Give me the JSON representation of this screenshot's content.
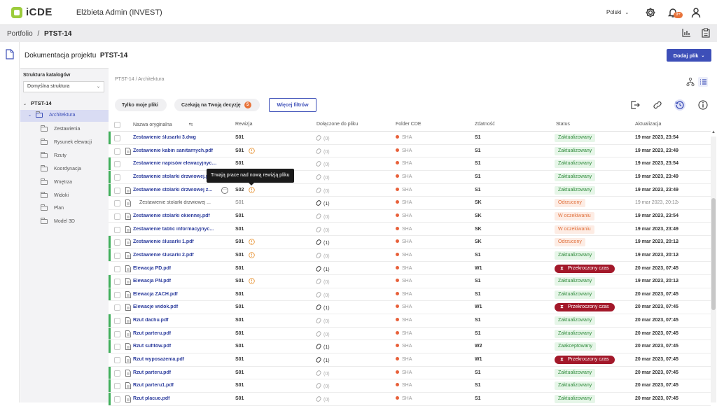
{
  "app": {
    "logo": "iCDE",
    "user_title": "Elżbieta Admin (INVEST)",
    "language": "Polski",
    "notifications_badge": "9+"
  },
  "breadcrumb": {
    "root": "Portfolio",
    "separator": "/",
    "current": "PTST-14"
  },
  "page": {
    "title_prefix": "Dokumentacja projektu",
    "title_project": "PTST-14",
    "add_button": "Dodaj plik"
  },
  "tree": {
    "header": "Struktura katalogów",
    "structure_select": "Domyślna struktura",
    "root": "PTST-14",
    "selected": "Architektura",
    "folders": [
      "Zestawienia",
      "Rysunek elewacji",
      "Rzuty",
      "Koordynacja",
      "Wnętrza",
      "Widoki",
      "Plan",
      "Model 3D"
    ]
  },
  "main_breadcrumb": "PTST-14  /  Architektura",
  "filters": {
    "only_mine": "Tylko moje pliki",
    "awaiting": "Czekają na Twoją decyzję",
    "awaiting_count": "5",
    "more": "Więcej filtrów"
  },
  "columns": {
    "name": "Nazwa oryginalna",
    "revision": "Rewizja",
    "attached": "Dołączone do pliku",
    "folder": "Folder CDE",
    "fitness": "Zdatność",
    "status": "Status",
    "updated": "Aktualizacja"
  },
  "tooltip": "Trwają prace nad nową rewizją pliku",
  "rows": [
    {
      "name": "Zestawienie ślusarki 3.dwg",
      "rev": "S01",
      "att": "(0)",
      "folder": "SHA",
      "fit": "S1",
      "status": "Zaktualizowany",
      "st": "green",
      "upd": "19 mar 2023, 23:54",
      "bar": true,
      "warn": false,
      "file": false
    },
    {
      "name": "Zestawienie kabin sanitarnych.pdf",
      "rev": "S01",
      "att": "(0)",
      "folder": "SHA",
      "fit": "S1",
      "status": "Zaktualizowany",
      "st": "green",
      "upd": "19 mar 2023, 23:49",
      "bar": false,
      "warn": true,
      "file": true
    },
    {
      "name": "Zestawienie napisów elewacyjnych.pdf",
      "rev": "S01",
      "att": "(0)",
      "folder": "SHA",
      "fit": "S1",
      "status": "Zaktualizowany",
      "st": "green",
      "upd": "19 mar 2023, 23:54",
      "bar": true,
      "warn": false,
      "file": false
    },
    {
      "name": "Zestawienie stolarki drzwiowej.pdf",
      "rev": "S01",
      "att": "(0)",
      "folder": "SHA",
      "fit": "S1",
      "status": "Zaktualizowany",
      "st": "green",
      "upd": "19 mar 2023, 23:49",
      "bar": true,
      "warn": false,
      "file": false
    },
    {
      "name": "Zestawienie stolarki drzwiowej z...",
      "rev": "S02",
      "att": "(0)",
      "folder": "SHA",
      "fit": "S1",
      "status": "Zaktualizowany",
      "st": "green",
      "upd": "19 mar 2023, 23:49",
      "bar": true,
      "warn": true,
      "file": true,
      "dots": true
    },
    {
      "name": "Zestawienie stolarki drzwiowej ...",
      "rev": "S01",
      "att": "(1)",
      "folder": "SHA",
      "fit": "SK",
      "status": "Odrzucony",
      "st": "orange",
      "upd": "19 mar 2023, 20:12",
      "bar": false,
      "warn": false,
      "file": true,
      "sub": true
    },
    {
      "name": "Zestawienie stolarki okiennej.pdf",
      "rev": "S01",
      "att": "(0)",
      "folder": "SHA",
      "fit": "SK",
      "status": "W oczekiwaniu",
      "st": "orange",
      "upd": "19 mar 2023, 23:54",
      "bar": false,
      "warn": false,
      "file": true
    },
    {
      "name": "Zestawienie tablic informacyjnyc...",
      "rev": "S01",
      "att": "(0)",
      "folder": "SHA",
      "fit": "SK",
      "status": "W oczekiwaniu",
      "st": "orange",
      "upd": "19 mar 2023, 23:49",
      "bar": false,
      "warn": false,
      "file": true
    },
    {
      "name": "Zestawienie ślusarki 1.pdf",
      "rev": "S01",
      "att": "(1)",
      "folder": "SHA",
      "fit": "SK",
      "status": "Odrzucony",
      "st": "orange",
      "upd": "19 mar 2023, 20:12",
      "bar": true,
      "warn": true,
      "file": true
    },
    {
      "name": "Zestawienie ślusarki 2.pdf",
      "rev": "S01",
      "att": "(0)",
      "folder": "SHA",
      "fit": "S1",
      "status": "Zaktualizowany",
      "st": "green",
      "upd": "19 mar 2023, 20:12",
      "bar": true,
      "warn": true,
      "file": true
    },
    {
      "name": "Elewacja PD.pdf",
      "rev": "S01",
      "att": "(1)",
      "folder": "SHA",
      "fit": "W1",
      "status": "Przekroczony czas",
      "st": "red",
      "upd": "20 mar 2023, 07:45",
      "bar": false,
      "warn": false,
      "file": true
    },
    {
      "name": "Elewacja PN.pdf",
      "rev": "S01",
      "att": "(0)",
      "folder": "SHA",
      "fit": "S1",
      "status": "Zaktualizowany",
      "st": "green",
      "upd": "19 mar 2023, 20:12",
      "bar": true,
      "warn": true,
      "file": true
    },
    {
      "name": "Elewacja ZACH.pdf",
      "rev": "S01",
      "att": "(0)",
      "folder": "SHA",
      "fit": "S1",
      "status": "Zaktualizowany",
      "st": "green",
      "upd": "20 mar 2023, 07:45",
      "bar": true,
      "warn": false,
      "file": true
    },
    {
      "name": "Elewacje widok.pdf",
      "rev": "S01",
      "att": "(1)",
      "folder": "SHA",
      "fit": "W1",
      "status": "Przekroczony czas",
      "st": "red",
      "upd": "20 mar 2023, 07:45",
      "bar": false,
      "warn": false,
      "file": true
    },
    {
      "name": "Rzut dachu.pdf",
      "rev": "S01",
      "att": "(0)",
      "folder": "SHA",
      "fit": "S1",
      "status": "Zaktualizowany",
      "st": "green",
      "upd": "20 mar 2023, 07:45",
      "bar": true,
      "warn": false,
      "file": true
    },
    {
      "name": "Rzut parteru.pdf",
      "rev": "S01",
      "att": "(0)",
      "folder": "SHA",
      "fit": "S1",
      "status": "Zaktualizowany",
      "st": "green",
      "upd": "20 mar 2023, 07:45",
      "bar": true,
      "warn": false,
      "file": true
    },
    {
      "name": "Rzut sufitów.pdf",
      "rev": "S01",
      "att": "(1)",
      "folder": "SHA",
      "fit": "W2",
      "status": "Zaakceptowany",
      "st": "green",
      "upd": "20 mar 2023, 07:45",
      "bar": true,
      "warn": false,
      "file": true
    },
    {
      "name": "Rzut wyposażenia.pdf",
      "rev": "S01",
      "att": "(1)",
      "folder": "SHA",
      "fit": "W1",
      "status": "Przekroczony czas",
      "st": "red",
      "upd": "20 mar 2023, 07:45",
      "bar": false,
      "warn": false,
      "file": true
    },
    {
      "name": "Rzut parteru.pdf",
      "rev": "S01",
      "att": "(0)",
      "folder": "SHA",
      "fit": "S1",
      "status": "Zaktualizowany",
      "st": "green",
      "upd": "20 mar 2023, 07:45",
      "bar": true,
      "warn": false,
      "file": true
    },
    {
      "name": "Rzut parteru1.pdf",
      "rev": "S01",
      "att": "(0)",
      "folder": "SHA",
      "fit": "S1",
      "status": "Zaktualizowany",
      "st": "green",
      "upd": "20 mar 2023, 07:45",
      "bar": true,
      "warn": false,
      "file": true
    },
    {
      "name": "Rzut placuo.pdf",
      "rev": "S01",
      "att": "(0)",
      "folder": "SHA",
      "fit": "S1",
      "status": "Zaktualizowany",
      "st": "green",
      "upd": "20 mar 2023, 07:45",
      "bar": true,
      "warn": false,
      "file": true
    }
  ],
  "colors": {
    "accent": "#3d4fb8",
    "link": "#2f3f9e",
    "green_bar": "#3fae5a",
    "orange": "#e8733a",
    "red": "#a3182a"
  }
}
